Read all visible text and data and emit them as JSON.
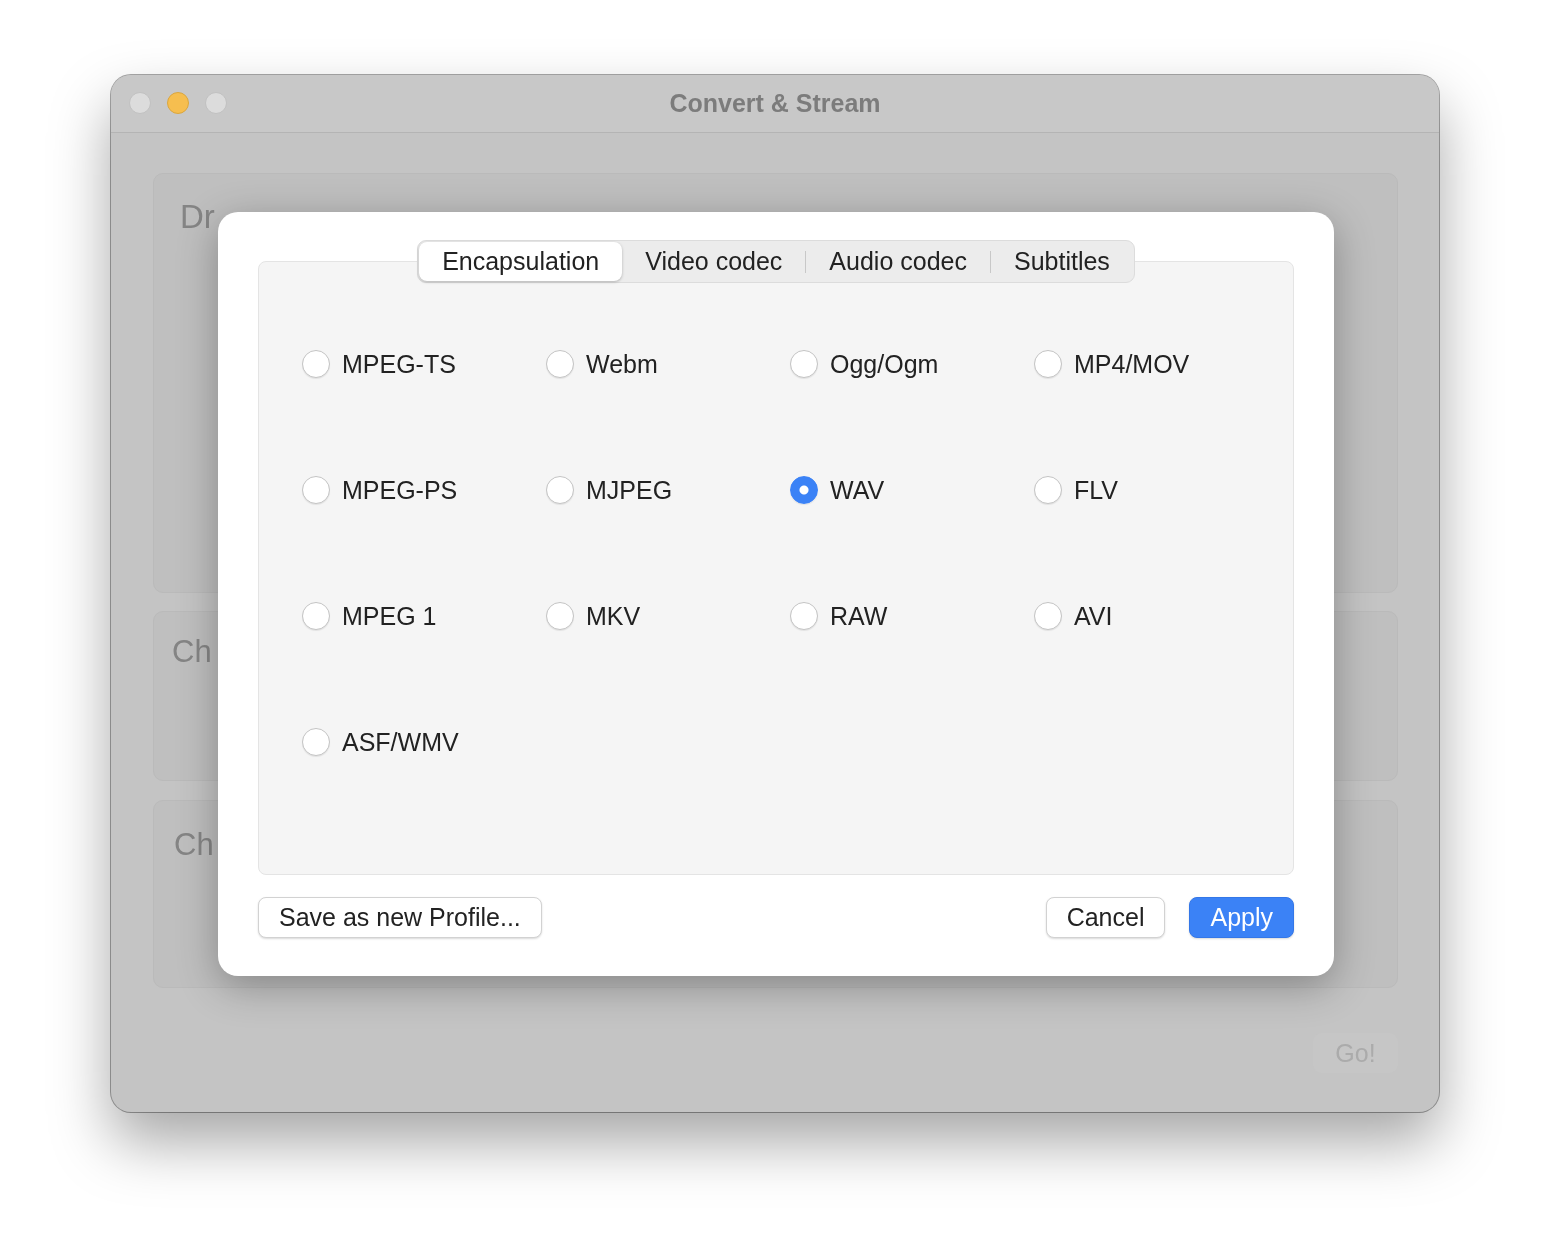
{
  "window": {
    "title": "Convert & Stream"
  },
  "background": {
    "drop_zone": "Dr",
    "panels": [
      "Ch",
      "Ch"
    ],
    "go_button": {
      "label": "Go!",
      "disabled": true
    }
  },
  "sheet": {
    "tabs": [
      {
        "label": "Encapsulation",
        "selected": true
      },
      {
        "label": "Video codec",
        "selected": false
      },
      {
        "label": "Audio codec",
        "selected": false
      },
      {
        "label": "Subtitles",
        "selected": false
      }
    ],
    "options": [
      {
        "label": "MPEG-TS",
        "selected": false
      },
      {
        "label": "Webm",
        "selected": false
      },
      {
        "label": "Ogg/Ogm",
        "selected": false
      },
      {
        "label": "MP4/MOV",
        "selected": false
      },
      {
        "label": "MPEG-PS",
        "selected": false
      },
      {
        "label": "MJPEG",
        "selected": false
      },
      {
        "label": "WAV",
        "selected": true
      },
      {
        "label": "FLV",
        "selected": false
      },
      {
        "label": "MPEG 1",
        "selected": false
      },
      {
        "label": "MKV",
        "selected": false
      },
      {
        "label": "RAW",
        "selected": false
      },
      {
        "label": "AVI",
        "selected": false
      },
      {
        "label": "ASF/WMV",
        "selected": false
      }
    ],
    "buttons": [
      {
        "label": "Save as new Profile...",
        "kind": "secondary"
      },
      {
        "label": "Cancel",
        "kind": "secondary"
      },
      {
        "label": "Apply",
        "kind": "primary"
      }
    ]
  }
}
